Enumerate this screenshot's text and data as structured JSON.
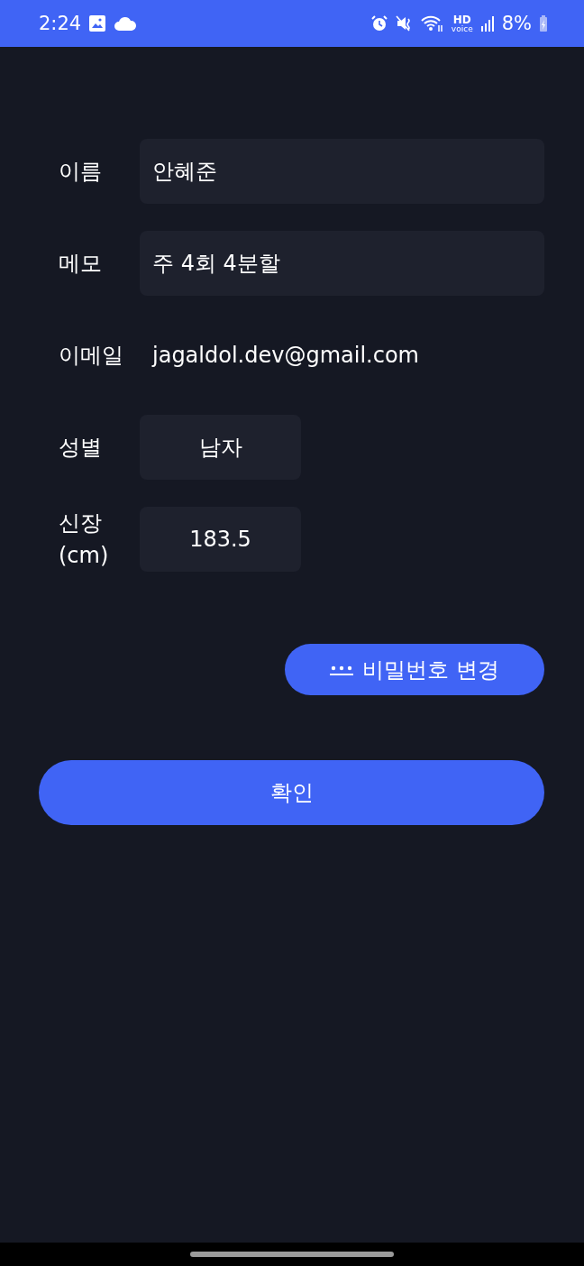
{
  "status_bar": {
    "time": "2:24",
    "hd": "HD",
    "voice": "voice",
    "battery": "8%"
  },
  "fields": [
    {
      "label": "이름",
      "kind": "input",
      "value": "안혜준"
    },
    {
      "label": "메모",
      "kind": "input",
      "value": "주 4회 4분할"
    },
    {
      "label": "이메일",
      "kind": "text",
      "value": "jagaldol.dev@gmail.com"
    },
    {
      "label": "성별",
      "kind": "short",
      "value": "남자"
    },
    {
      "label": "신장\n(cm)",
      "kind": "short",
      "value": "183.5"
    }
  ],
  "password_button": {
    "label": "비밀번호 변경"
  },
  "confirm_button": {
    "label": "확인"
  }
}
